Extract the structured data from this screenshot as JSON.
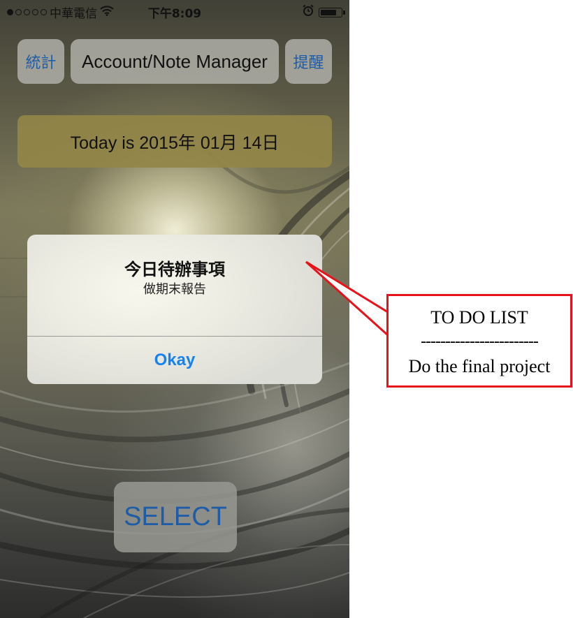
{
  "status_bar": {
    "carrier": "中華電信",
    "time": "下午8:09",
    "signal_bars_filled": 1,
    "signal_bars_total": 5,
    "battery_level": 0.8,
    "icons": [
      "wifi-icon",
      "alarm-icon",
      "battery-icon"
    ]
  },
  "header": {
    "stats_button": "統計",
    "title_button": "Account/Note Manager",
    "remind_button": "提醒"
  },
  "date_banner": {
    "text": "Today is 2015年 01月 14日"
  },
  "alert": {
    "title": "今日待辦事項",
    "message": "做期末報告",
    "ok_button": "Okay"
  },
  "select_button": {
    "label": "SELECT"
  },
  "annotation": {
    "title": "TO DO LIST",
    "separator": "------------------------",
    "text": "Do the final project"
  },
  "colors": {
    "accent_blue": "#1f5ca8",
    "alert_button_blue": "#1582f0",
    "date_banner": "#928548",
    "callout_red": "#e8131a"
  }
}
